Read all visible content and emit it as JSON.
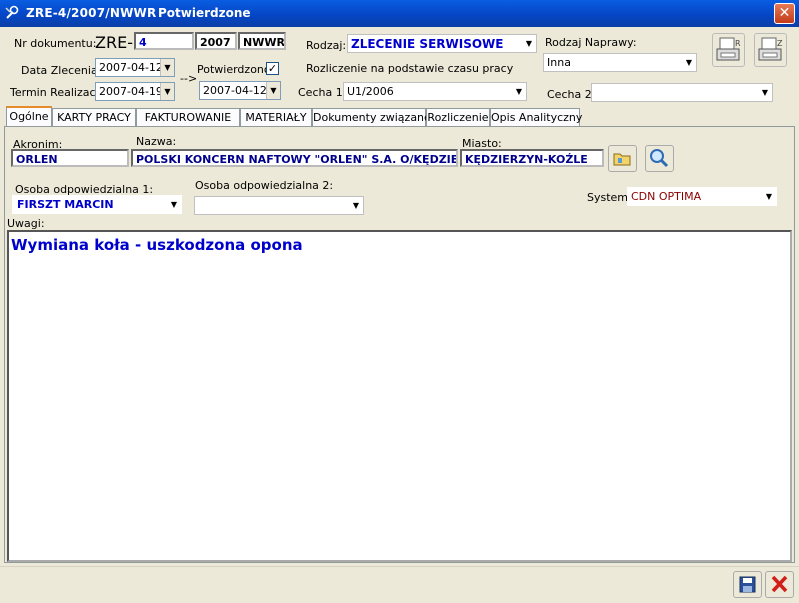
{
  "window": {
    "title": "ZRE-4/2007/NWWR",
    "status": "Potwierdzone",
    "close_symbol": "✕"
  },
  "header": {
    "nr_label": "Nr dokumentu:",
    "nr_prefix": "ZRE-",
    "nr_number": "4",
    "nr_year": "2007",
    "nr_series": "NWWR",
    "rodzaj_label": "Rodzaj:",
    "rodzaj_value": "ZLECENIE SERWISOWE",
    "rodzaj_naprawy_label": "Rodzaj Naprawy:",
    "rodzaj_naprawy_value": "Inna",
    "data_zlecenia_label": "Data Zlecenia:",
    "data_zlecenia_value": "2007-04-12",
    "arrow": "-->",
    "potwierdzono_label": "Potwierdzono:",
    "potwierdzono_check": "✓",
    "potwierdzono_date": "2007-04-12",
    "rozliczenie_label": "Rozliczenie na podstawie czasu pracy",
    "termin_label": "Termin Realizacji:",
    "termin_value": "2007-04-19",
    "cecha1_label": "Cecha 1:",
    "cecha1_value": "U1/2006",
    "cecha2_label": "Cecha 2:",
    "cecha2_value": ""
  },
  "tabs": [
    "Ogólne",
    "KARTY PRACY",
    "FAKTUROWANIE",
    "MATERIAŁY",
    "Dokumenty związane",
    "Rozliczenie",
    "Opis Analityczny"
  ],
  "general": {
    "akronim_label": "Akronim:",
    "akronim_value": "ORLEN",
    "nazwa_label": "Nazwa:",
    "nazwa_value": "POLSKI KONCERN NAFTOWY \"ORLEN\" S.A. O/KĘDZIE",
    "miasto_label": "Miasto:",
    "miasto_value": "KĘDZIERZYN-KOŹLE",
    "osoba1_label": "Osoba odpowiedzialna 1:",
    "osoba1_value": "FIRSZT MARCIN",
    "osoba2_label": "Osoba odpowiedzialna 2:",
    "osoba2_value": "",
    "system_label": "System:",
    "system_value": "CDN OPTIMA",
    "uwagi_label": "Uwagi:",
    "uwagi_value": "Wymiana koła - uszkodzona opona"
  },
  "colors": {
    "titlebar": "#0546c5",
    "value_blue": "#0000cc",
    "system_red": "#8b0000",
    "close_red": "#c33a1a"
  }
}
